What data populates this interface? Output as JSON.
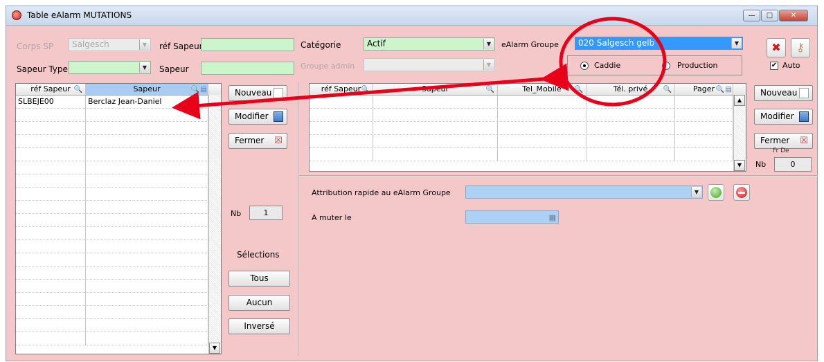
{
  "window": {
    "title": "Table eAlarm MUTATIONS",
    "min": "—",
    "max": "□",
    "close": "✕"
  },
  "filters": {
    "corps_label": "Corps SP",
    "corps_value": "Salgesch",
    "ref_sapeur_label": "réf Sapeur",
    "ref_sapeur_value": "",
    "categorie_label": "Catégorie",
    "categorie_value": "Actif",
    "ealarm_groupe_label": "eAlarm Groupe",
    "ealarm_groupe_value": "020 Salgesch gelb",
    "sapeur_type_label": "Sapeur Type",
    "sapeur_type_value": "",
    "sapeur_label": "Sapeur",
    "sapeur_value": "",
    "groupe_admin_label": "Groupe admin",
    "groupe_admin_value": "",
    "radio_caddie": "Caddie",
    "radio_production": "Production",
    "auto_label": "Auto"
  },
  "left_grid": {
    "headers": [
      "réf Sapeur",
      "Sapeur"
    ],
    "rows": [
      [
        "SLBEJE00",
        "Berclaz Jean-Daniel"
      ]
    ]
  },
  "left_actions": {
    "nouveau": "Nouveau",
    "modifier": "Modifier",
    "fermer": "Fermer",
    "nb_label": "Nb",
    "nb_value": "1",
    "selections_label": "Sélections",
    "tous": "Tous",
    "aucun": "Aucun",
    "inverse": "Inversé"
  },
  "right_grid": {
    "headers": [
      "réf Sapeur",
      "Sapeur",
      "Tel_Mobile",
      "Tél. privé",
      "Pager"
    ],
    "rows": []
  },
  "right_actions": {
    "nouveau": "Nouveau",
    "modifier": "Modifier",
    "fermer": "Fermer",
    "fr_de": "Fr   De",
    "nb_label": "Nb",
    "nb_value": "0"
  },
  "attribution": {
    "label": "Attribution rapide au eAlarm Groupe",
    "value": "",
    "muter_label": "A muter le",
    "muter_value": ""
  },
  "colors": {
    "background": "#f4c8c8",
    "field_green": "#ccf5cc",
    "field_blue": "#add0f5",
    "selected": "#3399ff",
    "annotation": "#e8001a"
  },
  "icons": [
    "app-icon",
    "delete-icon",
    "key-icon",
    "search-icon",
    "column-icon",
    "document-icon",
    "edit-icon",
    "close-x-icon",
    "calendar-icon",
    "ok-icon",
    "stop-icon"
  ]
}
